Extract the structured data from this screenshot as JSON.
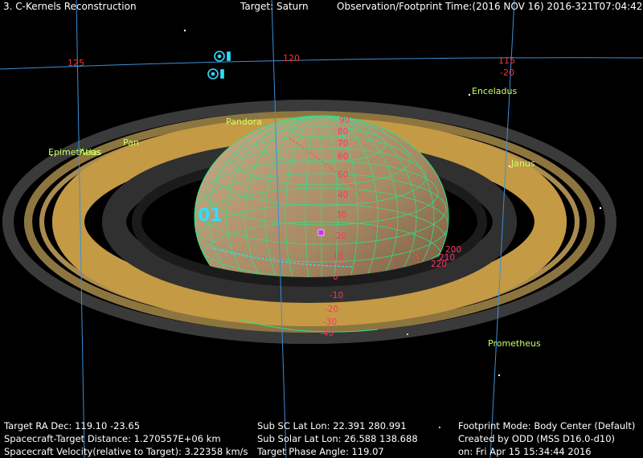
{
  "header": {
    "window_title": "3. C-Kernels Reconstruction",
    "target": "Target: Saturn",
    "observation_time": "Observation/Footprint Time:(2016 NOV 16) 2016-321T07:04:42.00"
  },
  "grid_labels": {
    "ra_125": "125",
    "ra_120": "120",
    "ra_115": "115",
    "dec_m20": "-20"
  },
  "moons": {
    "pandora": "Pandora",
    "pan": "Pan",
    "epimetheus": "Epimetheus",
    "atlas": "Atlas",
    "enceladus": "Enceladus",
    "janus": "Janus",
    "prometheus": "Prometheus"
  },
  "latitudes": {
    "l90": "90",
    "l80": "80",
    "l70": "70",
    "l60": "60",
    "l50": "50",
    "l40": "40",
    "l30": "30",
    "l20": "20",
    "l10": "10",
    "l0": "0",
    "lm10": "-10",
    "lm20": "-20",
    "lm30": "-30",
    "lm40": "-40",
    "lon200": "200",
    "lon210": "210",
    "lon220": "220"
  },
  "spacecraft_label": "01",
  "info": {
    "target_radec": "Target RA Dec: 119.10   -23.65",
    "distance": "Spacecraft-Target Distance: 1.270557E+06 km",
    "velocity": "Spacecraft Velocity(relative to Target): 3.22358 km/s",
    "sub_sc": "Sub SC Lat Lon: 22.391   280.991",
    "sub_solar": "Sub Solar Lat Lon: 26.588   138.688",
    "phase_angle": "Target Phase Angle: 119.07",
    "footprint_mode": "Footprint Mode: Body Center (Default)",
    "created_by": "Created by ODD (MSS D16.0-d10)",
    "created_on": "on: Fri Apr 15 15:34:44 2016"
  },
  "colors": {
    "grid_lines": "#3b8fd8",
    "planet_grid": "#2de08a",
    "ring_gold": "#c49a45",
    "ring_dark": "#2f2f2f",
    "label_red": "#ff3030",
    "moon_label": "#ccff66",
    "icon_cyan": "#33ddff"
  },
  "icons": [
    "target-marker-icon",
    "sun-marker-icon",
    "footprint-square-icon"
  ]
}
